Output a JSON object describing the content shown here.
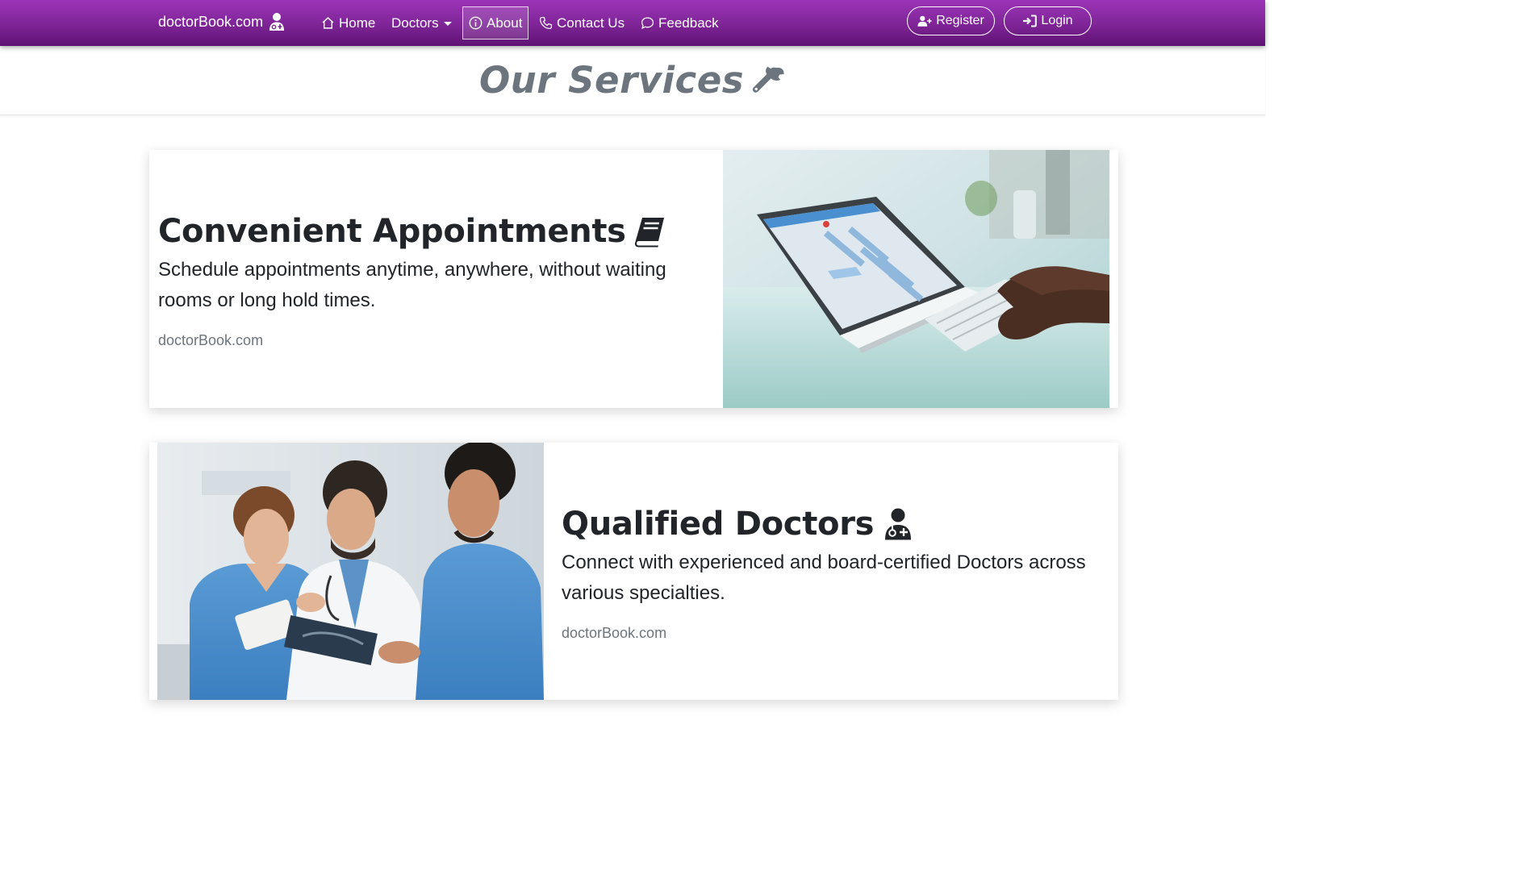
{
  "navbar": {
    "brand": "doctorBook.com",
    "items": [
      {
        "label": "Home"
      },
      {
        "label": "Doctors"
      },
      {
        "label": "About"
      },
      {
        "label": "Contact Us"
      },
      {
        "label": "Feedback"
      }
    ],
    "register_label": "Register",
    "login_label": "Login"
  },
  "header": {
    "title": "Our Services",
    "icon": "wrench-icon"
  },
  "services": [
    {
      "title": "Convenient Appointments",
      "icon": "book-icon",
      "text": "Schedule appointments anytime, anywhere, without waiting rooms or long hold times.",
      "meta": "doctorBook.com",
      "image": "laptop-calendar-photo"
    },
    {
      "title": "Qualified Doctors",
      "icon": "doctor-icon",
      "text": "Connect with experienced and board-certified Doctors across various specialties.",
      "meta": "doctorBook.com",
      "image": "doctors-team-photo"
    }
  ],
  "colors": {
    "navbar_top": "#9c35b8",
    "navbar_bottom": "#5e1272",
    "title_gray": "#6c757d",
    "text_dark": "#212529"
  }
}
